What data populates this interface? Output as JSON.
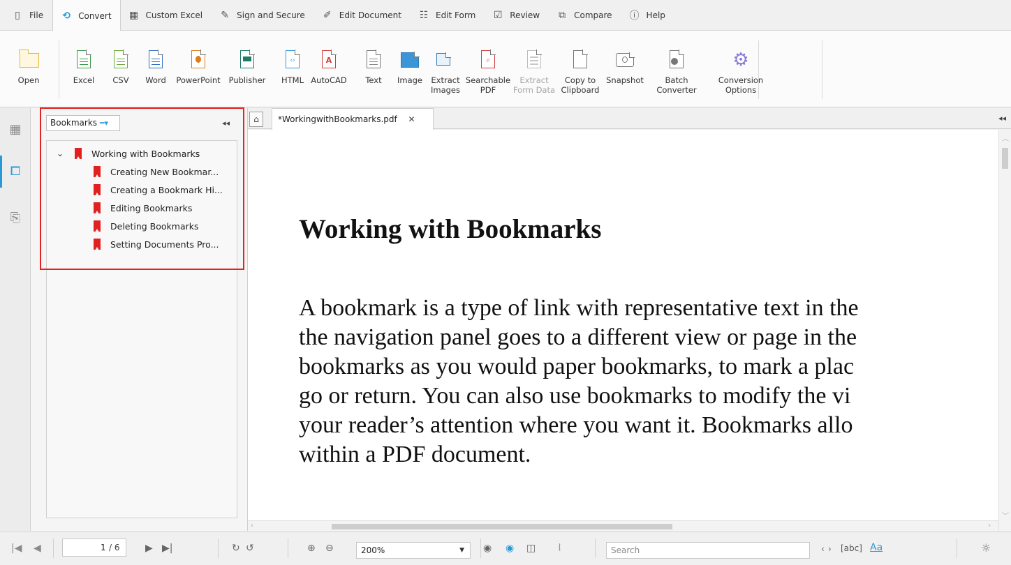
{
  "menu": {
    "tabs": [
      {
        "label": "File",
        "icon": "file-icon"
      },
      {
        "label": "Convert",
        "icon": "convert-icon"
      },
      {
        "label": "Custom Excel",
        "icon": "grid-icon"
      },
      {
        "label": "Sign and Secure",
        "icon": "pen-icon"
      },
      {
        "label": "Edit Document",
        "icon": "edit-icon"
      },
      {
        "label": "Edit Form",
        "icon": "form-icon"
      },
      {
        "label": "Review",
        "icon": "review-icon"
      },
      {
        "label": "Compare",
        "icon": "compare-icon"
      },
      {
        "label": "Help",
        "icon": "help-icon"
      }
    ],
    "active": "Convert"
  },
  "ribbon": {
    "open": "Open",
    "excel": "Excel",
    "csv": "CSV",
    "word": "Word",
    "powerpoint": "PowerPoint",
    "publisher": "Publisher",
    "html": "HTML",
    "autocad": "AutoCAD",
    "text": "Text",
    "image": "Image",
    "extract_images": "Extract\nImages",
    "searchable_pdf": "Searchable\nPDF",
    "extract_form_data": "Extract\nForm Data",
    "copy_clipboard": "Copy to\nClipboard",
    "snapshot": "Snapshot",
    "batch_converter": "Batch\nConverter",
    "conversion_options": "Conversion\nOptions"
  },
  "panel": {
    "title": "Bookmarks",
    "items": [
      {
        "label": "Working with Bookmarks"
      },
      {
        "label": "Creating New Bookmar..."
      },
      {
        "label": "Creating a Bookmark Hi..."
      },
      {
        "label": "Editing Bookmarks"
      },
      {
        "label": "Deleting Bookmarks"
      },
      {
        "label": "Setting Documents Pro..."
      }
    ]
  },
  "document": {
    "tab_title": "*WorkingwithBookmarks.pdf",
    "heading": "Working with Bookmarks",
    "body_lines": [
      "A bookmark is a type of link with representative text in the",
      "the navigation panel goes to a different view or page in the",
      "bookmarks as you would paper bookmarks, to mark a plac",
      "go or return. You can also use bookmarks to modify the vi",
      "your reader’s attention where you want it. Bookmarks allo",
      "within a PDF document."
    ]
  },
  "status": {
    "current_page": "1",
    "total_pages": "/ 6",
    "zoom": "200%",
    "search_placeholder": "Search"
  },
  "colors": {
    "accent": "#2a9ad6",
    "bookmark": "#e12020",
    "highlight_box": "#e02424"
  }
}
